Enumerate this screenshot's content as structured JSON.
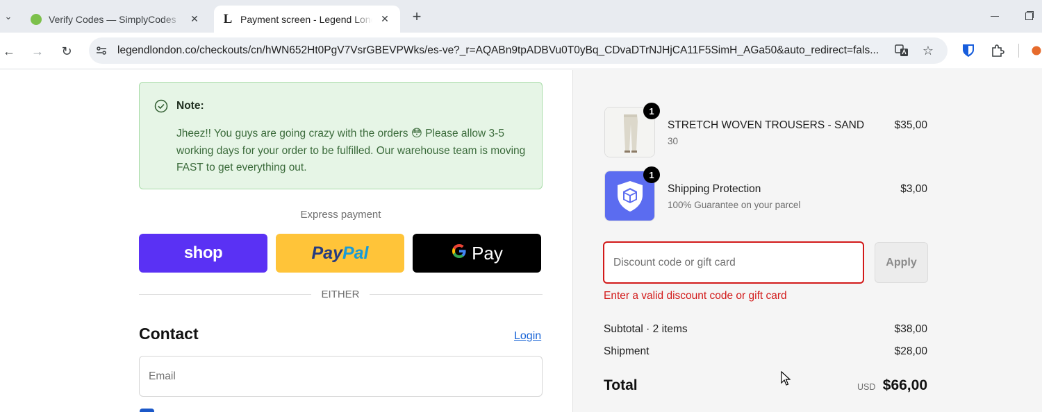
{
  "browser": {
    "tabs": [
      {
        "title": "Verify Codes — SimplyCodes",
        "icon": "simplycodes-favicon",
        "active": false
      },
      {
        "title": "Payment screen - Legend London",
        "icon": "legend-l-favicon",
        "active": true
      }
    ],
    "favicon_letter": "L",
    "url": "legendlondon.co/checkouts/cn/hWN652Ht0PgV7VsrGBEVPWks/es-ve?_r=AQABn9tpADBVu0T0yBq_CDvaDTrNJHjCA11F5SimH_AGa50&auto_redirect=fals..."
  },
  "note": {
    "title": "Note:",
    "body": "Jheez!! You guys are going crazy with the orders 😳 Please allow 3-5 working days for your order to be fulfilled. Our warehouse team is moving FAST to get everything out."
  },
  "express": {
    "label": "Express payment",
    "shop_label": "shop",
    "paypal_part1": "Pay",
    "paypal_part2": "Pal",
    "gpay_label": "Pay"
  },
  "divider_text": "EITHER",
  "contact": {
    "title": "Contact",
    "login_label": "Login",
    "email_placeholder": "Email"
  },
  "summary": {
    "items": [
      {
        "name": "STRETCH WOVEN TROUSERS - SAND",
        "variant": "30",
        "price": "$35,00",
        "qty": "1"
      },
      {
        "name": "Shipping Protection",
        "variant": "100% Guarantee on your parcel",
        "price": "$3,00",
        "qty": "1"
      }
    ],
    "discount_placeholder": "Discount code or gift card",
    "apply_label": "Apply",
    "discount_error": "Enter a valid discount code or gift card",
    "subtotal_label": "Subtotal · 2 items",
    "subtotal_value": "$38,00",
    "shipment_label": "Shipment",
    "shipment_value": "$28,00",
    "total_label": "Total",
    "total_currency": "USD",
    "total_value": "$66,00"
  },
  "colors": {
    "shop": "#5a31f4",
    "paypal": "#ffc439",
    "error": "#d21919",
    "note_bg": "#e6f5e6",
    "link": "#1663d6"
  }
}
